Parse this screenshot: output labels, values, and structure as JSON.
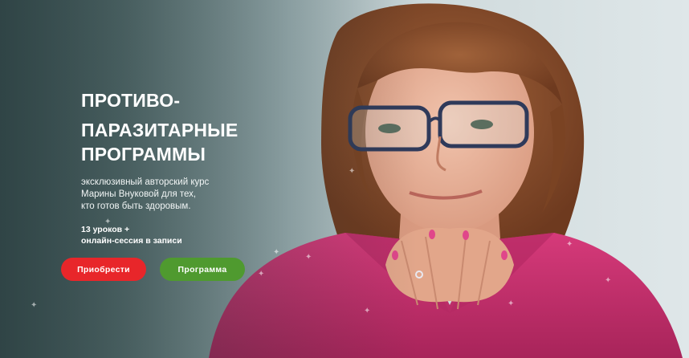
{
  "hero": {
    "title_line1": "ПРОТИВО-",
    "title_line2": "ПАРАЗИТАРНЫЕ",
    "title_line3": "ПРОГРАММЫ",
    "desc_line1": "эксклюзивный авторский курс",
    "desc_line2": "Марины Внуковой для тех,",
    "desc_line3": "кто готов быть здоровым.",
    "lessons_line1": "13 уроков +",
    "lessons_line2": "онлайн-сессия в записи"
  },
  "buttons": {
    "buy_label": "Приобрести",
    "program_label": "Программа"
  },
  "colors": {
    "buy": "#e8262a",
    "program": "#4f9a2f",
    "jacket": "#c9306f",
    "hair": "#8a4d2b"
  },
  "icons": {
    "sparkle": "sparkle-icon"
  }
}
